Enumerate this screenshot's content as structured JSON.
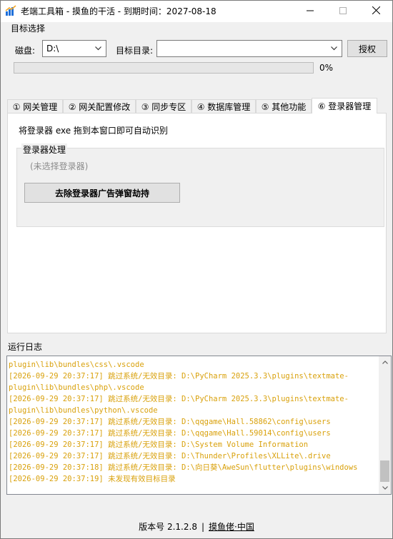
{
  "window": {
    "title": "老端工具箱 - 摸鱼的干活 - 到期时间：2027-08-18",
    "icons": {
      "app": "app-logo-icon",
      "minimize": "minimize-icon",
      "maximize": "maximize-icon",
      "close": "close-icon"
    }
  },
  "target": {
    "group_title": "目标选择",
    "disk_label": "磁盘:",
    "disk_value": "D:\\",
    "dir_label": "目标目录:",
    "dir_value": "",
    "authorize_label": "授权",
    "progress": 0,
    "progress_text": "0%"
  },
  "tabs": [
    {
      "label": "① 网关管理"
    },
    {
      "label": "② 网关配置修改"
    },
    {
      "label": "③ 同步专区"
    },
    {
      "label": "④ 数据库管理"
    },
    {
      "label": "⑤ 其他功能"
    },
    {
      "label": "⑥ 登录器管理"
    }
  ],
  "active_tab": 5,
  "panel": {
    "hint": "将登录器 exe 拖到本窗口即可自动识别",
    "group_title": "登录器处理",
    "status": "(未选择登录器)",
    "action_label": "去除登录器广告弹窗劫持"
  },
  "log": {
    "title": "运行日志",
    "lines": [
      "plugin\\lib\\bundles\\css\\.vscode",
      "[2026-09-29 20:37:17] 跳过系统/无效目录: D:\\PyCharm 2025.3.3\\plugins\\textmate-",
      "plugin\\lib\\bundles\\php\\.vscode",
      "[2026-09-29 20:37:17] 跳过系统/无效目录: D:\\PyCharm 2025.3.3\\plugins\\textmate-",
      "plugin\\lib\\bundles\\python\\.vscode",
      "[2026-09-29 20:37:17] 跳过系统/无效目录: D:\\qqgame\\Hall.58862\\config\\users",
      "[2026-09-29 20:37:17] 跳过系统/无效目录: D:\\qqgame\\Hall.59014\\config\\users",
      "[2026-09-29 20:37:17] 跳过系统/无效目录: D:\\System Volume Information",
      "[2026-09-29 20:37:17] 跳过系统/无效目录: D:\\Thunder\\Profiles\\XLLite\\.drive",
      "[2026-09-29 20:37:18] 跳过系统/无效目录: D:\\向日葵\\AweSun\\flutter\\plugins\\windows",
      "[2026-09-29 20:37:19] 未发现有效目标目录"
    ],
    "text_color": "#d9a10c"
  },
  "footer": {
    "version": "版本号 2.1.2.8",
    "separator": "|",
    "link": "摸鱼佬·中国"
  }
}
